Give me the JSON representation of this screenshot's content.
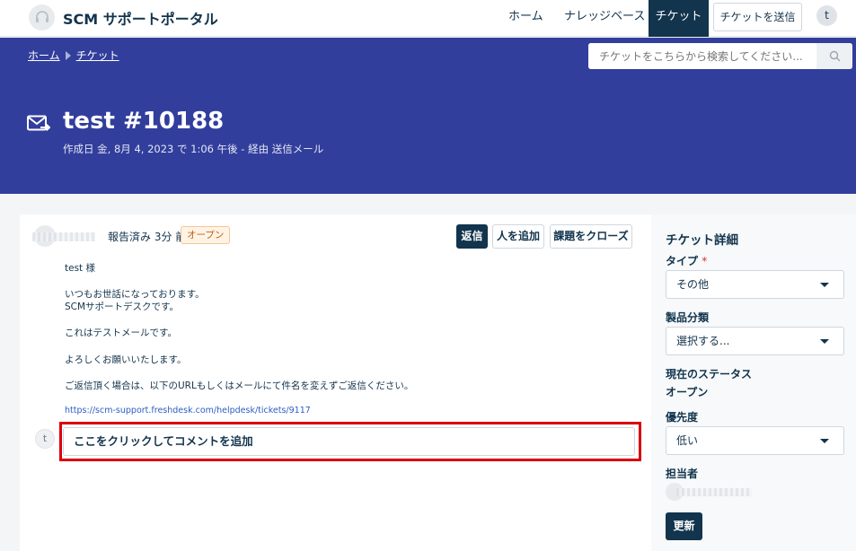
{
  "header": {
    "brand": "SCM サポートポータル",
    "nav": {
      "home": "ホーム",
      "knowledge_base": "ナレッジベース",
      "tickets": "チケット",
      "submit_ticket": "チケットを送信"
    },
    "user_initial": "t"
  },
  "breadcrumb": {
    "home": "ホーム",
    "tickets": "チケット"
  },
  "search": {
    "placeholder": "チケットをこちらから検索してください..."
  },
  "ticket": {
    "title": "test #10188",
    "subtitle": "作成日 金, 8月 4, 2023 で 1:06 午後 - 経由 送信メール",
    "reported": "報告済み 3分 前",
    "status": "オープン",
    "actions": {
      "reply": "返信",
      "add_people": "人を追加",
      "close": "課題をクローズ"
    },
    "message": {
      "greeting": "test 様",
      "line1": "いつもお世話になっております。",
      "line2": "SCMサポートデスクです。",
      "line3": "これはテストメールです。",
      "line4": "よろしくお願いいたします。",
      "line5": "ご返信頂く場合は、以下のURLもしくはメールにて件名を変えずご返信ください。",
      "link": "https://scm-support.freshdesk.com/helpdesk/tickets/9117"
    },
    "comment": {
      "avatar_initial": "t",
      "placeholder": "ここをクリックしてコメントを追加"
    }
  },
  "details": {
    "title": "チケット詳細",
    "type_label": "タイプ",
    "required_mark": "*",
    "type_value": "その他",
    "product_label": "製品分類",
    "product_value": "選択する...",
    "status_label": "現在のステータス",
    "status_value": "オープン",
    "priority_label": "優先度",
    "priority_value": "低い",
    "assignee_label": "担当者",
    "update_button": "更新"
  },
  "colors": {
    "banner": "#323e9c",
    "primary": "#12344d",
    "highlight": "#d9000e",
    "link": "#2c5cc5"
  }
}
